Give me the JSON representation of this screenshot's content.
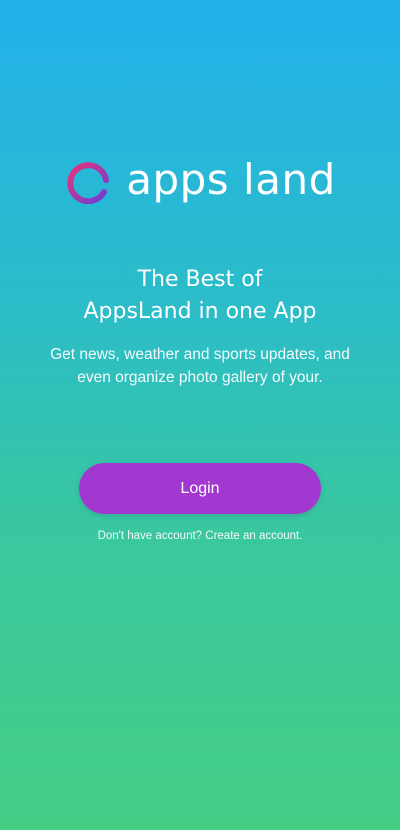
{
  "brand": {
    "logo_icon": "q-ring-logo-icon",
    "name": "apps land",
    "gradient_start": "#e8327a",
    "gradient_end": "#6a3fd6"
  },
  "headline": {
    "line1": "The Best of",
    "line2": "AppsLand in one App"
  },
  "description": {
    "line1": "Get news, weather and sports updates, and",
    "line2": "even organize photo gallery of your."
  },
  "actions": {
    "login_label": "Login",
    "login_color": "#a238d0",
    "signup_prompt": "Don't have account?",
    "signup_link": "Create an account."
  },
  "background": {
    "top_color": "#22b1ea",
    "bottom_color": "#45cd84"
  }
}
